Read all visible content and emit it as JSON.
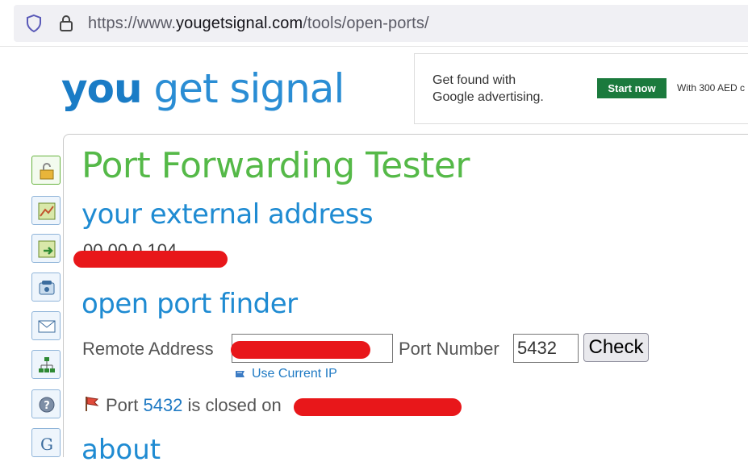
{
  "browser": {
    "url_prefix": "https://www.",
    "url_domain": "yougetsignal.com",
    "url_path": "/tools/open-ports/"
  },
  "logo": {
    "part1": "you",
    "part2": " get signal"
  },
  "ad": {
    "line1": "Get found with",
    "line2": "Google advertising.",
    "button": "Start now",
    "sub": "With 300 AED c"
  },
  "page": {
    "title": "Port Forwarding Tester",
    "external_heading": "your external address",
    "external_ip_partial": "00.00.0.104",
    "finder_heading": "open port finder",
    "remote_label": "Remote Address",
    "port_label": "Port Number",
    "port_value": "5432",
    "check_label": "Check",
    "use_current_ip": "Use Current IP",
    "result_prefix": "Port ",
    "result_port": "5432",
    "result_suffix": " is closed on",
    "about_heading": "about"
  },
  "colors": {
    "title_green": "#55b948",
    "heading_blue": "#1f8bd2",
    "redaction_red": "#e8171a",
    "ad_button_green": "#1b7a3d"
  },
  "side_icons": [
    "lock-open-icon",
    "map-icon",
    "map-arrow-icon",
    "phone-icon",
    "mail-icon",
    "network-icon",
    "help-icon",
    "google-icon"
  ]
}
